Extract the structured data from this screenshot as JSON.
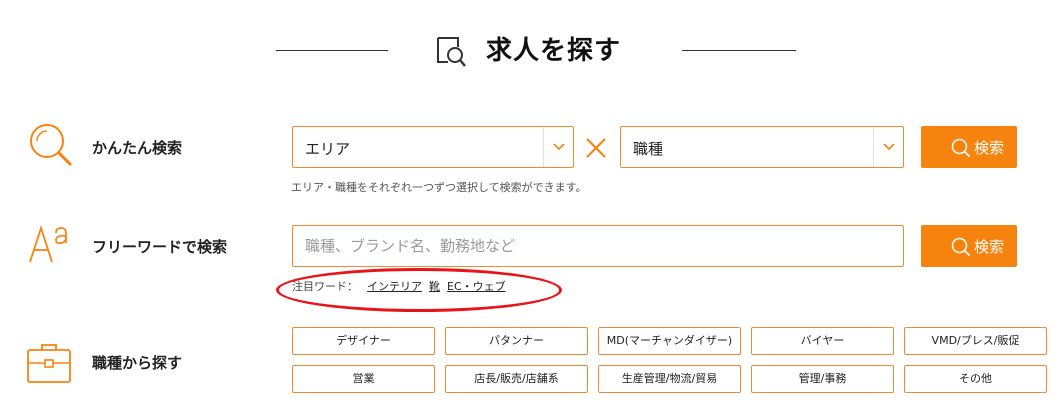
{
  "header": {
    "title": "求人を探す",
    "icon": "search-document-icon"
  },
  "accent_color": "#f7830f",
  "easy_search": {
    "label": "かんたん検索",
    "icon": "magnifier-icon",
    "area_select": {
      "value": "エリア"
    },
    "separator": "×",
    "job_select": {
      "value": "職種"
    },
    "search_button": "検索",
    "note": "エリア・職種をそれぞれ一つずつ選択して検索ができます。"
  },
  "freeword_search": {
    "label": "フリーワードで検索",
    "icon": "font-aa-icon",
    "placeholder": "職種、ブランド名、勤務地など",
    "search_button": "検索",
    "trending_label": "注目ワード：",
    "trending_words": [
      "インテリア",
      "靴",
      "EC・ウェブ"
    ]
  },
  "job_category": {
    "label": "職種から探す",
    "icon": "briefcase-icon",
    "categories": [
      "デザイナー",
      "パタンナー",
      "MD(マーチャンダイザー)",
      "バイヤー",
      "VMD/プレス/販促",
      "営業",
      "店長/販売/店舗系",
      "生産管理/物流/貿易",
      "管理/事務",
      "その他"
    ]
  }
}
